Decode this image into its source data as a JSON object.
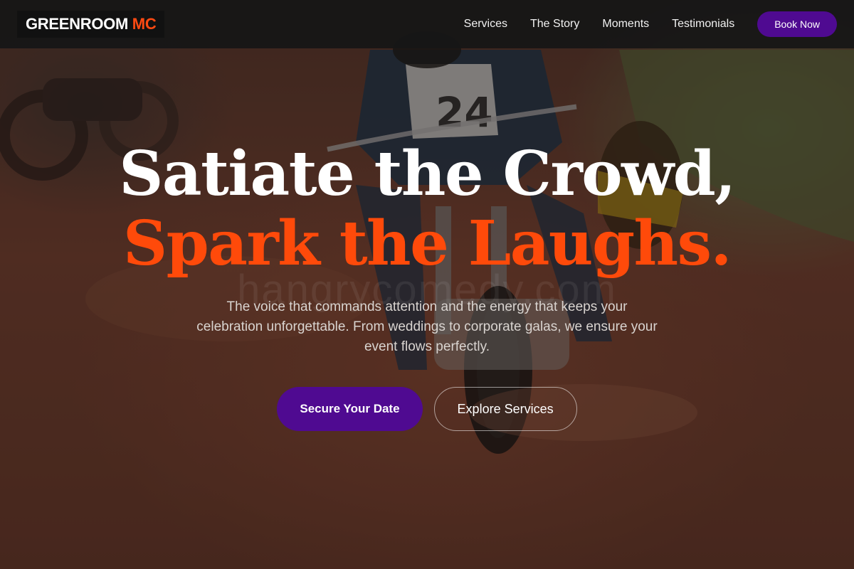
{
  "brand": {
    "name_main": "GREENROOM",
    "name_accent": "MC",
    "accent_color": "#ff4a12"
  },
  "nav": {
    "links": [
      {
        "label": "Services"
      },
      {
        "label": "The Story"
      },
      {
        "label": "Moments"
      },
      {
        "label": "Testimonials"
      }
    ],
    "cta_label": "Book Now"
  },
  "hero": {
    "headline_line1": "Satiate the Crowd,",
    "headline_line2": "Spark the Laughs.",
    "subtext": "The voice that commands attention and the energy that keeps your celebration unforgettable. From weddings to corporate galas, we ensure your event flows perfectly.",
    "primary_cta": "Secure Your Date",
    "secondary_cta": "Explore Services",
    "watermark": "hangrycomedy.com",
    "background_image": "dirt-track-motorcycle-race-photo"
  },
  "colors": {
    "primary": "#4f0a91",
    "accent": "#ff4a0a",
    "navbar": "#161616"
  }
}
